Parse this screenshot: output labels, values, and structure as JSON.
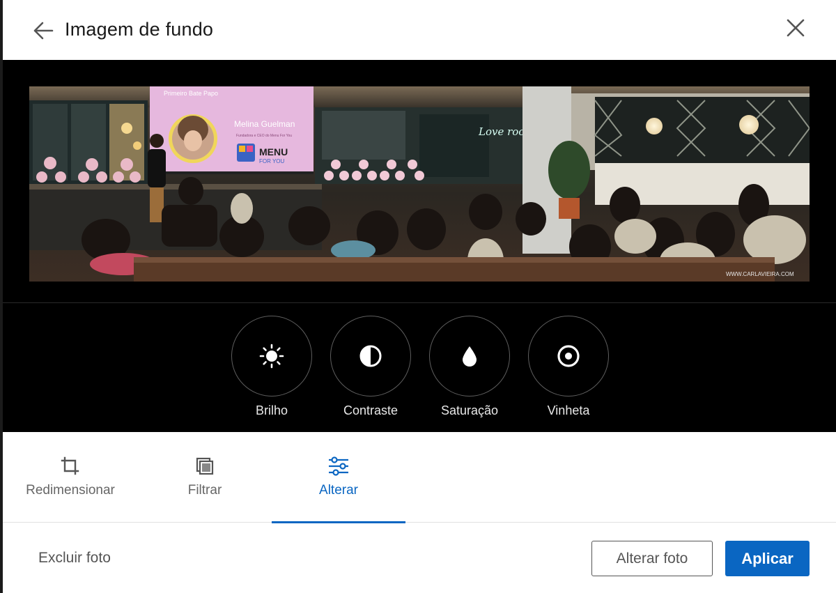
{
  "header": {
    "title": "Imagem de fundo",
    "back_icon": "arrow-left-icon",
    "close_icon": "close-icon"
  },
  "photo": {
    "slide_heading": "Primeiro Bate Papo",
    "slide_speaker": "Melina Guelman",
    "slide_subtitle": "Fundadora e CEO do Menu For You",
    "slide_logo_line1": "MENU",
    "slide_logo_line2": "FOR YOU",
    "neon_sign": "Love rooms",
    "watermark": "WWW.CARLAVIEIRA.COM"
  },
  "adjust_tools": [
    {
      "id": "brightness",
      "label": "Brilho",
      "icon": "sun-icon"
    },
    {
      "id": "contrast",
      "label": "Contraste",
      "icon": "contrast-icon"
    },
    {
      "id": "saturation",
      "label": "Saturação",
      "icon": "droplet-icon"
    },
    {
      "id": "vignette",
      "label": "Vinheta",
      "icon": "vignette-icon"
    }
  ],
  "tabs": [
    {
      "id": "resize",
      "label": "Redimensionar",
      "icon": "crop-icon",
      "active": false
    },
    {
      "id": "filter",
      "label": "Filtrar",
      "icon": "filter-icon",
      "active": false
    },
    {
      "id": "adjust",
      "label": "Alterar",
      "icon": "sliders-icon",
      "active": true
    }
  ],
  "footer": {
    "delete_label": "Excluir foto",
    "change_label": "Alterar foto",
    "apply_label": "Aplicar"
  },
  "colors": {
    "accent": "#0a66c2",
    "stage_background": "#000000",
    "muted_text": "#666666"
  }
}
